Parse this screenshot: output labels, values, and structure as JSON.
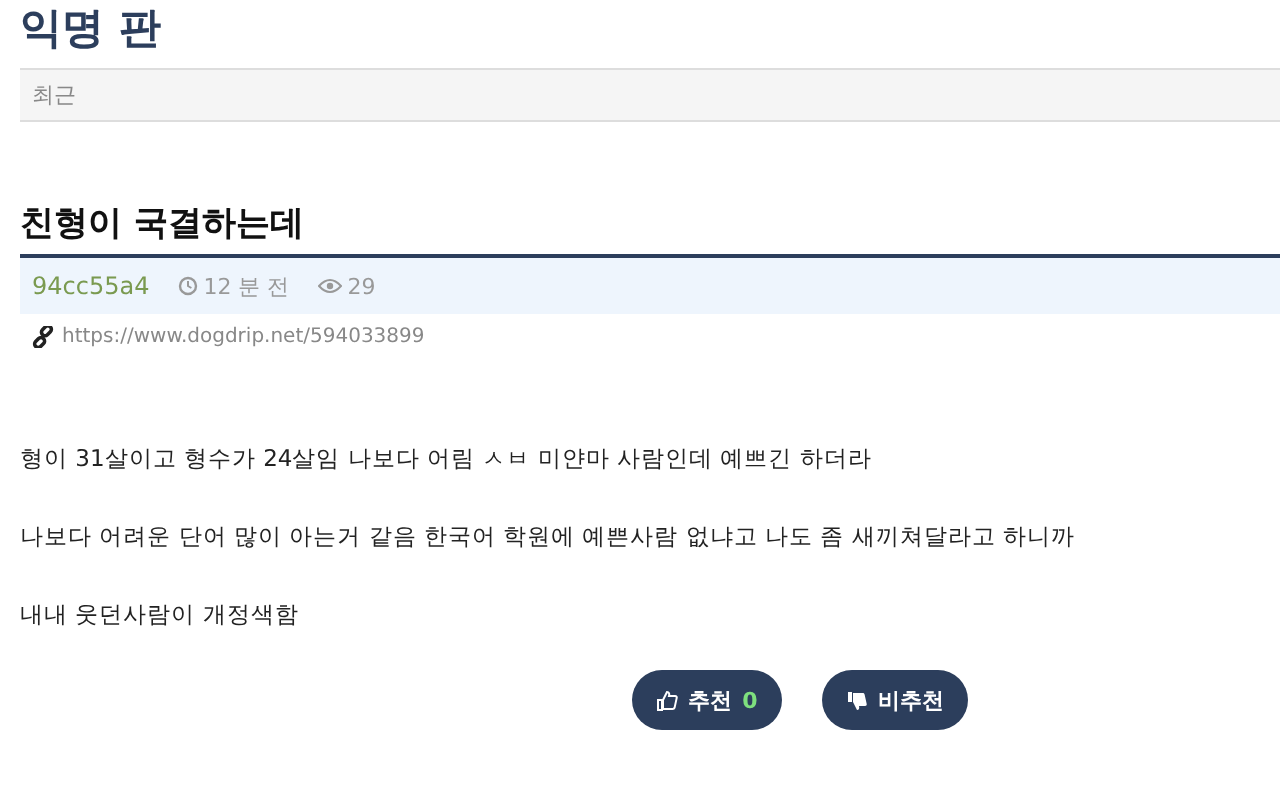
{
  "board": {
    "title": "익명 판"
  },
  "tabs": [
    {
      "label": "최근",
      "selected": false
    }
  ],
  "post": {
    "title": "친형이 국결하는데",
    "author": "94cc55a4",
    "time": "12 분 전",
    "views": "29",
    "link": "https://www.dogdrip.net/594033899",
    "paragraphs": [
      "형이 31살이고 형수가 24살임 나보다 어림 ㅅㅂ 미얀마 사람인데 예쁘긴 하더라",
      "나보다 어려운 단어 많이 아는거 같음 한국어 학원에 예쁜사람 없냐고 나도 좀 새끼쳐달라고 하니까",
      "내내 웃던사람이 개정색함"
    ]
  },
  "votes": {
    "up_label": "추천",
    "up_count": "0",
    "down_label": "비추천"
  }
}
